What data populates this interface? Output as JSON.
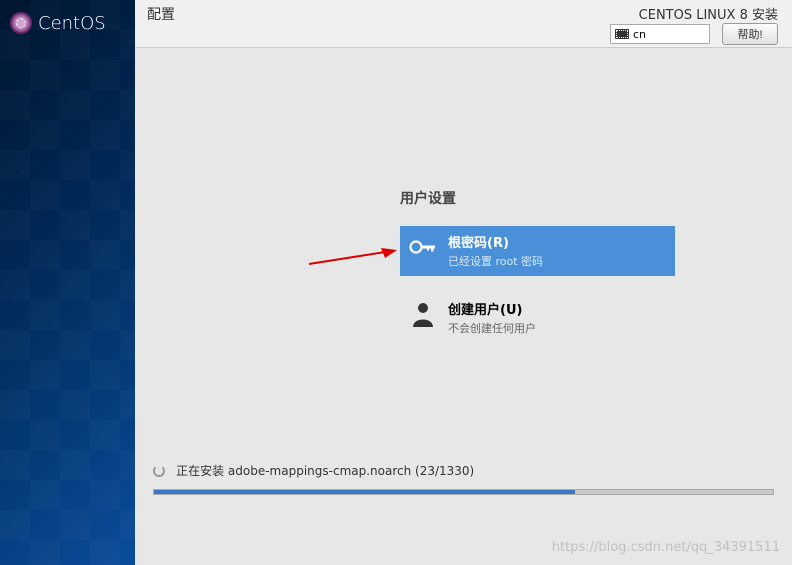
{
  "brand": "CentOS",
  "header": {
    "page_title": "配置",
    "install_title": "CENTOS LINUX 8 安装",
    "lang_code": "cn",
    "help_label": "帮助!"
  },
  "user_settings": {
    "section_title": "用户设置",
    "root": {
      "title": "根密码(R)",
      "subtitle": "已经设置 root 密码"
    },
    "create_user": {
      "title": "创建用户(U)",
      "subtitle": "不会创建任何用户"
    }
  },
  "progress": {
    "text": "正在安装 adobe-mappings-cmap.noarch (23/1330)"
  },
  "watermark": "https://blog.csdn.net/qq_34391511"
}
